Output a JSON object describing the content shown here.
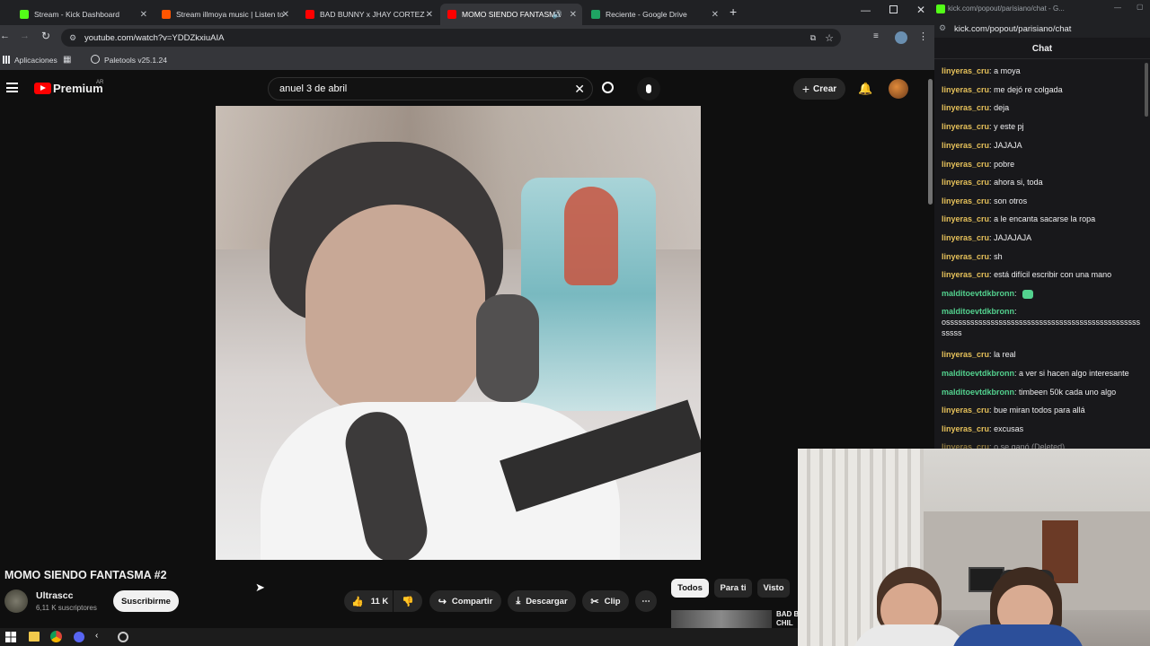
{
  "browser": {
    "tabs": [
      {
        "label": "Stream - Kick Dashboard",
        "color": "#53fc18"
      },
      {
        "label": "Stream illmoya music | Listen to",
        "color": "#ff5500"
      },
      {
        "label": "BAD BUNNY x JHAY CORTEZ - ",
        "color": "#ff0000"
      },
      {
        "label": "MOMO SIENDO FANTASMA",
        "color": "#ff0000"
      },
      {
        "label": "Reciente - Google Drive",
        "color": "#1fa463"
      }
    ],
    "new_tab": "+",
    "url": "youtube.com/watch?v=YDDZkxiuAIA",
    "bookmarks": [
      "Aplicaciones",
      "Paletools v25.1.24"
    ]
  },
  "youtube": {
    "logo": "Premium",
    "region": "AR",
    "search_value": "anuel 3 de abril",
    "create_label": "Crear",
    "video_title": "MOMO SIENDO FANTASMA #2",
    "channel": "Ultrascc",
    "subscribers": "6,11 K suscriptores",
    "subscribe_label": "Suscribirme",
    "likes": "11 K",
    "share_label": "Compartir",
    "download_label": "Descargar",
    "clip_label": "Clip",
    "more_label": "⋯",
    "chips": [
      "Todos",
      "Para ti",
      "Visto"
    ],
    "rec_snippet": "BAD B\nCHIL"
  },
  "chat": {
    "window_title": "kick.com/popout/parisiano/chat - G...",
    "url": "kick.com/popout/parisiano/chat",
    "header": "Chat",
    "messages": [
      {
        "user": "linyeras_cru",
        "text": "a moya",
        "color": "#e6c15a"
      },
      {
        "user": "linyeras_cru",
        "text": "me dejó re colgada",
        "color": "#e6c15a"
      },
      {
        "user": "linyeras_cru",
        "text": "deja",
        "color": "#e6c15a"
      },
      {
        "user": "linyeras_cru",
        "text": "y este pj",
        "color": "#e6c15a"
      },
      {
        "user": "linyeras_cru",
        "text": "JAJAJA",
        "color": "#e6c15a"
      },
      {
        "user": "linyeras_cru",
        "text": "pobre",
        "color": "#e6c15a"
      },
      {
        "user": "linyeras_cru",
        "text": "ahora si, toda",
        "color": "#e6c15a"
      },
      {
        "user": "linyeras_cru",
        "text": "son otros",
        "color": "#e6c15a"
      },
      {
        "user": "linyeras_cru",
        "text": "a le encanta sacarse la ropa",
        "color": "#e6c15a"
      },
      {
        "user": "linyeras_cru",
        "text": "JAJAJAJA",
        "color": "#e6c15a"
      },
      {
        "user": "linyeras_cru",
        "text": "sh",
        "color": "#e6c15a"
      },
      {
        "user": "linyeras_cru",
        "text": "está difícil escribir con una mano",
        "color": "#e6c15a"
      },
      {
        "user": "malditoevtdkbronn",
        "text": "",
        "color": "#53d18e"
      },
      {
        "user": "malditoevtdkbronn",
        "text": "osssssssssssssssssssssssssssssssssssssssssssssssssssss",
        "color": "#53d18e"
      },
      {
        "user": "linyeras_cru",
        "text": "la real",
        "color": "#e6c15a"
      },
      {
        "user": "malditoevtdkbronn",
        "text": "a ver si hacen algo interesante",
        "color": "#53d18e"
      },
      {
        "user": "malditoevtdkbronn",
        "text": "timbeen 50k cada uno algo",
        "color": "#53d18e"
      },
      {
        "user": "linyeras_cru",
        "text": "bue miran todos para allá",
        "color": "#e6c15a"
      },
      {
        "user": "linyeras_cru",
        "text": "excusas",
        "color": "#e6c15a"
      },
      {
        "user": "linyeras_cru",
        "text": "o se ganó (Deleted)",
        "color": "#e6c15a"
      }
    ]
  }
}
